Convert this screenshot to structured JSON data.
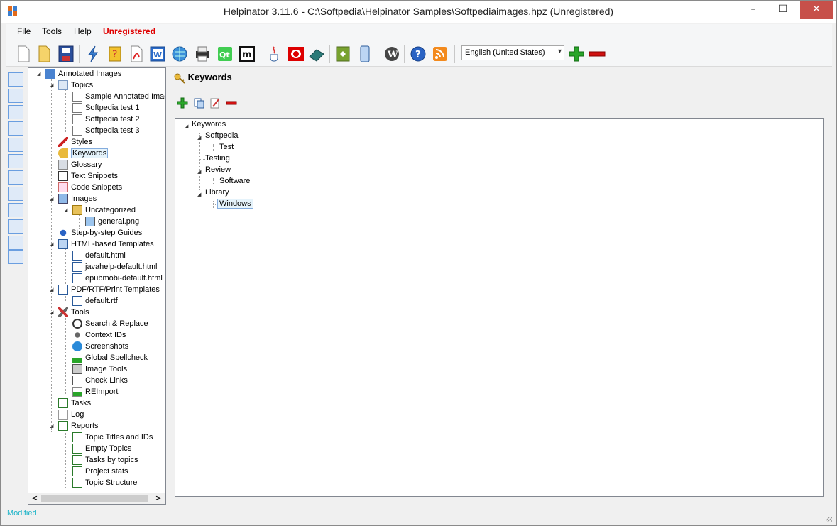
{
  "window": {
    "title": "Helpinator 3.11.6 - C:\\Softpedia\\Helpinator Samples\\Softpediaimages.hpz (Unregistered)",
    "minimize": "–",
    "maximize": "☐",
    "close": "✕"
  },
  "menu": {
    "file": "File",
    "tools": "Tools",
    "help": "Help",
    "unregistered": "Unregistered"
  },
  "toolbar": {
    "language": "English (United States)",
    "language_arrow": "▾"
  },
  "tree": {
    "root": "Annotated Images",
    "topics": "Topics",
    "topic1": "Sample Annotated Imag",
    "topic2": "Softpedia test 1",
    "topic3": "Softpedia test 2",
    "topic4": "Softpedia test 3",
    "styles": "Styles",
    "keywords": "Keywords",
    "glossary": "Glossary",
    "text_snippets": "Text Snippets",
    "code_snippets": "Code Snippets",
    "images": "Images",
    "uncategorized": "Uncategorized",
    "general_png": "general.png",
    "step_guides": "Step-by-step Guides",
    "html_templates": "HTML-based Templates",
    "default_html": "default.html",
    "javahelp": "javahelp-default.html",
    "epubmobi": "epubmobi-default.html",
    "pdf_templates": "PDF/RTF/Print Templates",
    "default_rtf": "default.rtf",
    "tools": "Tools",
    "search_replace": "Search & Replace",
    "context_ids": "Context IDs",
    "screenshots": "Screenshots",
    "spellcheck": "Global Spellcheck",
    "image_tools": "Image Tools",
    "check_links": "Check Links",
    "reimport": "REImport",
    "tasks": "Tasks",
    "log": "Log",
    "reports": "Reports",
    "topic_titles": "Topic Titles and IDs",
    "empty_topics": "Empty Topics",
    "tasks_by_topics": "Tasks by topics",
    "project_stats": "Project stats",
    "topic_structure": "Topic Structure"
  },
  "keywords_panel": {
    "header": "Keywords",
    "root": "Keywords",
    "k1": "Softpedia",
    "k1a": "Test",
    "k2": "Testing",
    "k3": "Review",
    "k3a": "Software",
    "k4": "Library",
    "k4a": "Windows"
  },
  "status": {
    "text": "Modified"
  },
  "scroll": {
    "left": "<",
    "right": ">"
  },
  "colors": {
    "unregistered": "#e00000",
    "accent_green": "#2aa52a",
    "accent_red": "#d01010",
    "status": "#1db4c8"
  }
}
